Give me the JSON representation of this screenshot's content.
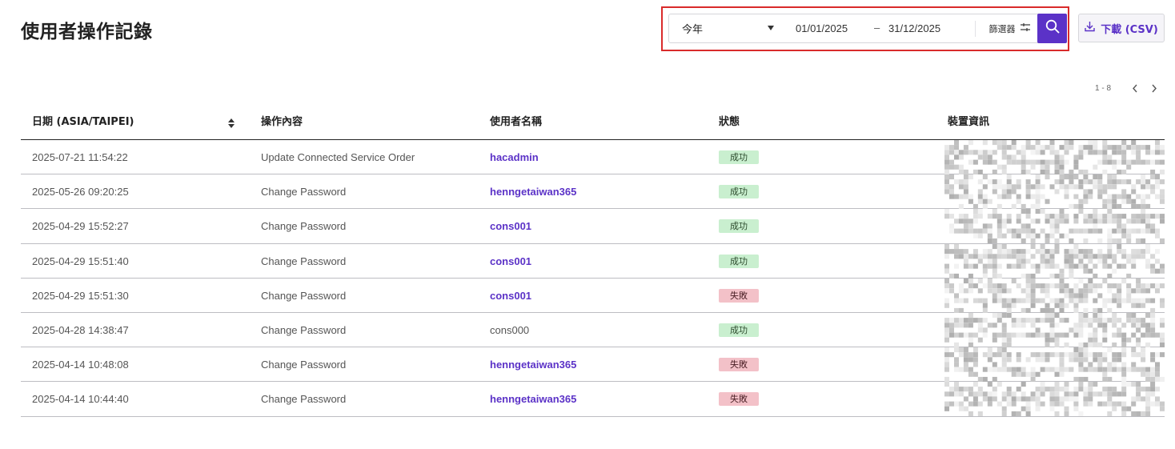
{
  "page": {
    "title": "使用者操作記錄"
  },
  "filter": {
    "period_selected": "今年",
    "date_start": "01/01/2025",
    "date_separator": "–",
    "date_end": "31/12/2025",
    "filter_label": "篩選器",
    "search_icon": "search-icon",
    "filter_icon": "sliders-icon"
  },
  "download": {
    "label": "下載 (CSV)",
    "icon": "download-icon"
  },
  "pagination": {
    "range": "1 - 8"
  },
  "table": {
    "headers": {
      "date": "日期 (ASIA/TAIPEI)",
      "operation": "操作內容",
      "user": "使用者名稱",
      "status": "狀態",
      "device": "裝置資訊"
    },
    "rows": [
      {
        "date": "2025-07-21 11:54:22",
        "operation": "Update Connected Service Order",
        "user": "hacadmin",
        "status": "成功",
        "status_type": "success",
        "linked": true
      },
      {
        "date": "2025-05-26 09:20:25",
        "operation": "Change Password",
        "user": "henngetaiwan365",
        "status": "成功",
        "status_type": "success",
        "linked": true
      },
      {
        "date": "2025-04-29 15:52:27",
        "operation": "Change Password",
        "user": "cons001",
        "status": "成功",
        "status_type": "success",
        "linked": true
      },
      {
        "date": "2025-04-29 15:51:40",
        "operation": "Change Password",
        "user": "cons001",
        "status": "成功",
        "status_type": "success",
        "linked": true
      },
      {
        "date": "2025-04-29 15:51:30",
        "operation": "Change Password",
        "user": "cons001",
        "status": "失敗",
        "status_type": "failure",
        "linked": true
      },
      {
        "date": "2025-04-28 14:38:47",
        "operation": "Change Password",
        "user": "cons000",
        "status": "成功",
        "status_type": "success",
        "linked": false
      },
      {
        "date": "2025-04-14 10:48:08",
        "operation": "Change Password",
        "user": "henngetaiwan365",
        "status": "失敗",
        "status_type": "failure",
        "linked": true
      },
      {
        "date": "2025-04-14 10:44:40",
        "operation": "Change Password",
        "user": "henngetaiwan365",
        "status": "失敗",
        "status_type": "failure",
        "linked": true
      }
    ]
  },
  "colors": {
    "accent": "#5b32c7",
    "success_bg": "#c9efcf",
    "failure_bg": "#f3c1c8",
    "highlight": "#d92b2b"
  }
}
